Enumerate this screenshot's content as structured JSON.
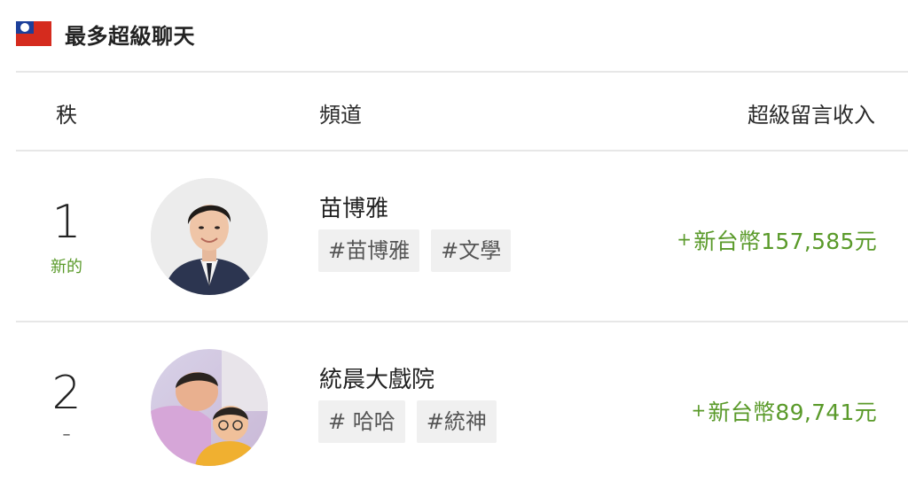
{
  "header": {
    "title": "最多超級聊天",
    "flag_icon": "taiwan-flag-icon"
  },
  "columns": {
    "rank": "秩",
    "channel": "頻道",
    "income": "超級留言收入"
  },
  "rows": [
    {
      "rank": "1",
      "change": "新的",
      "name": "苗博雅",
      "tags": [
        "#苗博雅",
        "#文學"
      ],
      "income": "新台幣157,585元",
      "income_prefix": "+"
    },
    {
      "rank": "2",
      "change": "–",
      "name": "統晨大戲院",
      "tags": [
        "# 哈哈",
        "#統神"
      ],
      "income": "新台幣89,741元",
      "income_prefix": "+"
    }
  ],
  "colors": {
    "accent_green": "#5a9a2a",
    "tag_bg": "#f0f0f0",
    "divider": "#e7e7e7"
  }
}
